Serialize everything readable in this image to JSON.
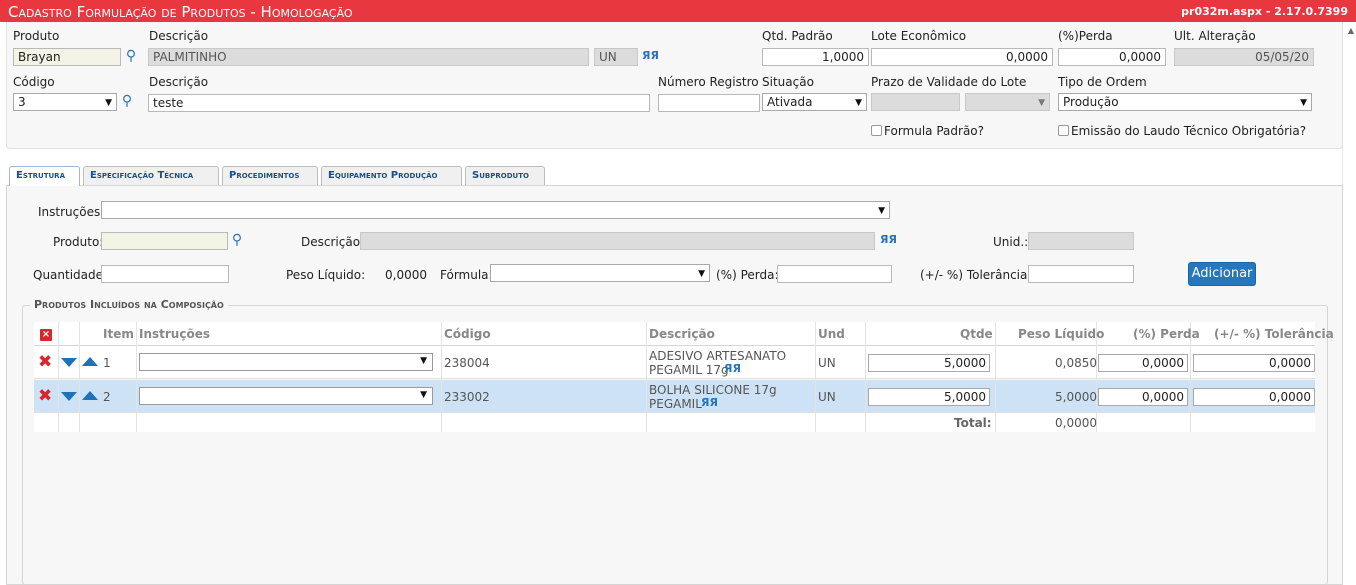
{
  "title": "Cadastro Formulação de Produtos  - Homologação",
  "version": "pr032m.aspx - 2.17.0.7399",
  "header": {
    "produto_label": "Produto",
    "produto_value": "Brayan",
    "descricao_label": "Descrição",
    "descricao_value": "PALMITINHO",
    "unidade_value": "UN",
    "qtd_padrao_label": "Qtd. Padrão",
    "qtd_padrao_value": "1,0000",
    "lote_label": "Lote Econômico",
    "lote_value": "0,0000",
    "perda_label": "(%)Perda",
    "perda_value": "0,0000",
    "ult_alt_label": "Ult. Alteração",
    "ult_alt_value": "05/05/20",
    "codigo_label": "Código",
    "codigo_value": "3",
    "descricao2_label": "Descrição",
    "descricao2_value": "teste",
    "num_registro_label": "Número Registro",
    "num_registro_value": "",
    "situacao_label": "Situação",
    "situacao_value": "Ativada",
    "prazo_label": "Prazo de Validade do Lote",
    "prazo_value": "",
    "prazo_unit_value": "",
    "tipo_ordem_label": "Tipo de Ordem",
    "tipo_ordem_value": "Produção",
    "formula_padrao_label": "Formula Padrão?",
    "laudo_label": "Emissão do Laudo Técnico Obrigatória?"
  },
  "tabs": [
    {
      "label": "Estrutura",
      "active": true
    },
    {
      "label": "Especificação Técnica"
    },
    {
      "label": "Procedimentos"
    },
    {
      "label": "Equipamento Produção"
    },
    {
      "label": "Subproduto"
    }
  ],
  "form": {
    "instrucoes_label": "Instruções:",
    "instrucoes_value": "",
    "produto_label": "Produto:",
    "produto_value": "",
    "descricao_label": "Descrição:",
    "descricao_value": "",
    "unid_label": "Unid.:",
    "unid_value": "",
    "quantidade_label": "Quantidade:",
    "quantidade_value": "",
    "peso_liquido_label": "Peso Líquido:",
    "peso_liquido_value": "0,0000",
    "formula_label": "Fórmula:",
    "formula_value": "",
    "perda_label": "(%) Perda:",
    "perda_value": "",
    "tolerancia_label": "(+/- %) Tolerância:",
    "tolerancia_value": "",
    "add_label": "Adicionar"
  },
  "composition": {
    "legend": "Produtos Incluídos na Composição",
    "columns": {
      "item": "Item",
      "instrucoes": "Instruções",
      "codigo": "Código",
      "descricao": "Descrição",
      "und": "Und",
      "qtde": "Qtde",
      "peso": "Peso Líquido",
      "perda": "(%) Perda",
      "tolerancia": "(+/- %) Tolerância"
    },
    "rows": [
      {
        "item": "1",
        "instrucoes": "",
        "codigo": "238004",
        "descricao1": "ADESIVO ARTESANATO",
        "descricao2": "PEGAMIL 17g",
        "und": "UN",
        "qtde": "5,0000",
        "peso": "0,0850",
        "perda": "0,0000",
        "tolerancia": "0,0000"
      },
      {
        "item": "2",
        "instrucoes": "",
        "codigo": "233002",
        "descricao1": "BOLHA SILICONE 17g",
        "descricao2": "PEGAMIL",
        "und": "UN",
        "qtde": "5,0000",
        "peso": "5,0000",
        "perda": "0,0000",
        "tolerancia": "0,0000"
      }
    ],
    "total_label": "Total:",
    "total_value": "0,0000"
  },
  "icons": {
    "search": "magnifier-icon",
    "binoculars": "binoculars-icon",
    "delete": "red-x-icon",
    "move_down": "triangle-down-icon",
    "move_up": "triangle-up-icon"
  },
  "colors": {
    "titlebar": "#e8373e",
    "accent": "#2678be",
    "selected_row": "#cde3f5"
  }
}
